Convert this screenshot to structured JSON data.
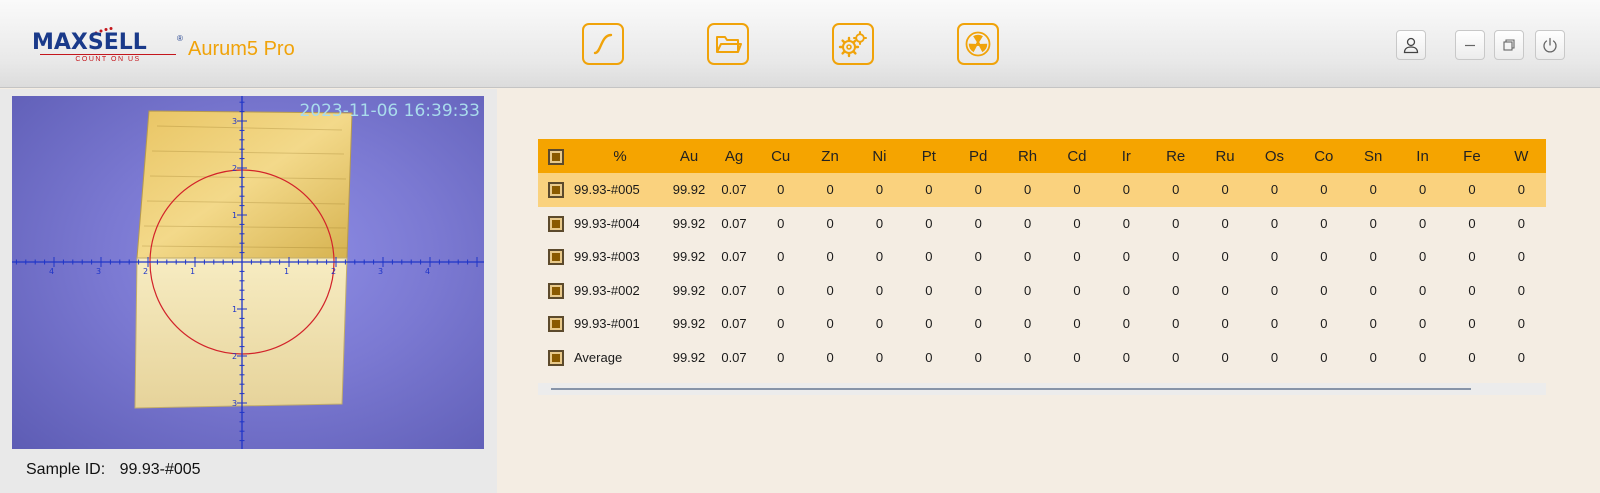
{
  "app": {
    "brand": "MAXSELL",
    "brand_tagline": "COUNT ON US",
    "brand_reg": "®",
    "title": "Aurum5 Pro",
    "accent_color": "#f0a30a"
  },
  "toolbar": {
    "buttons": [
      {
        "name": "calibration-curve",
        "icon": "curve-icon"
      },
      {
        "name": "open-folder",
        "icon": "folder-icon"
      },
      {
        "name": "settings",
        "icon": "gears-icon"
      },
      {
        "name": "radiation",
        "icon": "radiation-icon"
      }
    ]
  },
  "window_controls": {
    "user_icon": "user-icon",
    "minimize_icon": "minimize-icon",
    "restore_icon": "restore-icon",
    "power_icon": "power-icon"
  },
  "camera": {
    "timestamp": "2023-11-06 16:39:33",
    "x_ticks": [
      "4",
      "3",
      "2",
      "1",
      "1",
      "2",
      "3",
      "4"
    ],
    "y_ticks": [
      "3",
      "2",
      "1",
      "1",
      "2",
      "3"
    ]
  },
  "sample": {
    "label": "Sample ID:",
    "value": "99.93-#005"
  },
  "results": {
    "columns": [
      "%",
      "Au",
      "Ag",
      "Cu",
      "Zn",
      "Ni",
      "Pt",
      "Pd",
      "Rh",
      "Cd",
      "Ir",
      "Re",
      "Ru",
      "Os",
      "Co",
      "Sn",
      "In",
      "Fe",
      "W"
    ],
    "rows": [
      {
        "name": "99.93-#005",
        "selected": true,
        "values": [
          "99.92",
          "0.07",
          "0",
          "0",
          "0",
          "0",
          "0",
          "0",
          "0",
          "0",
          "0",
          "0",
          "0",
          "0",
          "0",
          "0",
          "0",
          "0"
        ]
      },
      {
        "name": "99.93-#004",
        "selected": false,
        "values": [
          "99.92",
          "0.07",
          "0",
          "0",
          "0",
          "0",
          "0",
          "0",
          "0",
          "0",
          "0",
          "0",
          "0",
          "0",
          "0",
          "0",
          "0",
          "0"
        ]
      },
      {
        "name": "99.93-#003",
        "selected": false,
        "values": [
          "99.92",
          "0.07",
          "0",
          "0",
          "0",
          "0",
          "0",
          "0",
          "0",
          "0",
          "0",
          "0",
          "0",
          "0",
          "0",
          "0",
          "0",
          "0"
        ]
      },
      {
        "name": "99.93-#002",
        "selected": false,
        "values": [
          "99.92",
          "0.07",
          "0",
          "0",
          "0",
          "0",
          "0",
          "0",
          "0",
          "0",
          "0",
          "0",
          "0",
          "0",
          "0",
          "0",
          "0",
          "0"
        ]
      },
      {
        "name": "99.93-#001",
        "selected": false,
        "values": [
          "99.92",
          "0.07",
          "0",
          "0",
          "0",
          "0",
          "0",
          "0",
          "0",
          "0",
          "0",
          "0",
          "0",
          "0",
          "0",
          "0",
          "0",
          "0"
        ]
      },
      {
        "name": "Average",
        "selected": false,
        "values": [
          "99.92",
          "0.07",
          "0",
          "0",
          "0",
          "0",
          "0",
          "0",
          "0",
          "0",
          "0",
          "0",
          "0",
          "0",
          "0",
          "0",
          "0",
          "0"
        ]
      }
    ]
  }
}
